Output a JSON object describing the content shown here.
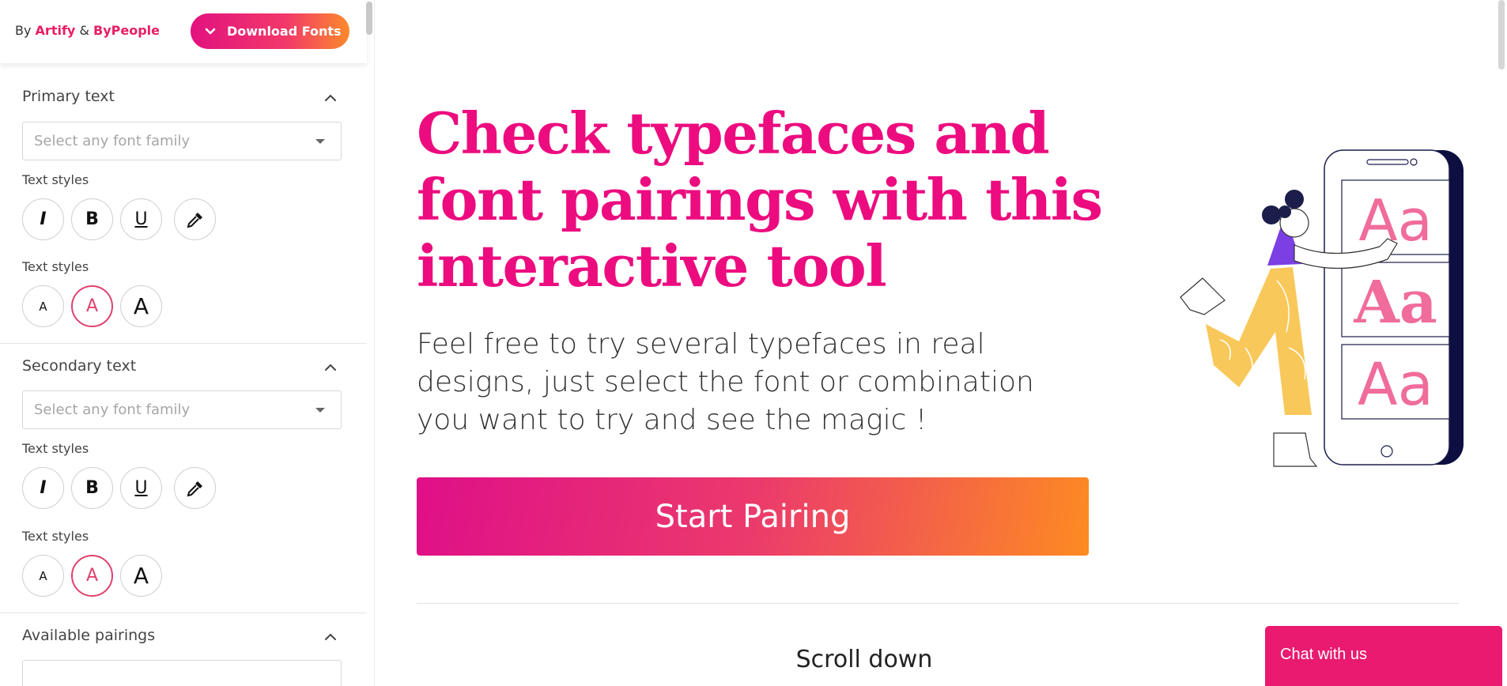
{
  "header": {
    "by_prefix": "By",
    "brand_1": "Artify",
    "ampersand": "&",
    "brand_2": "ByPeople",
    "download_label": "Download Fonts"
  },
  "sidebar": {
    "primary": {
      "title": "Primary text",
      "select_placeholder": "Select any font family",
      "styles_label_1": "Text styles",
      "styles_label_2": "Text styles",
      "format_buttons": [
        "I",
        "B",
        "U"
      ],
      "size_buttons": [
        "A",
        "A",
        "A"
      ]
    },
    "secondary": {
      "title": "Secondary text",
      "select_placeholder": "Select any font family",
      "styles_label_1": "Text styles",
      "styles_label_2": "Text styles",
      "format_buttons": [
        "I",
        "B",
        "U"
      ],
      "size_buttons": [
        "A",
        "A",
        "A"
      ]
    },
    "pairings": {
      "title": "Available pairings"
    }
  },
  "main": {
    "hero_title": "Check typefaces and font pairings with this interactive tool",
    "hero_subtitle": "Feel free to try several typefaces in real designs, just select the font or combination you want to try and see the magic !",
    "start_button": "Start Pairing",
    "scroll_hint": "Scroll down",
    "illustration_text": [
      "Aa",
      "Aa",
      "Aa"
    ]
  },
  "chat": {
    "label": "Chat with us"
  },
  "colors": {
    "accent": "#ec0c7f",
    "orange": "#fd8b22",
    "chat": "#e91a70"
  }
}
